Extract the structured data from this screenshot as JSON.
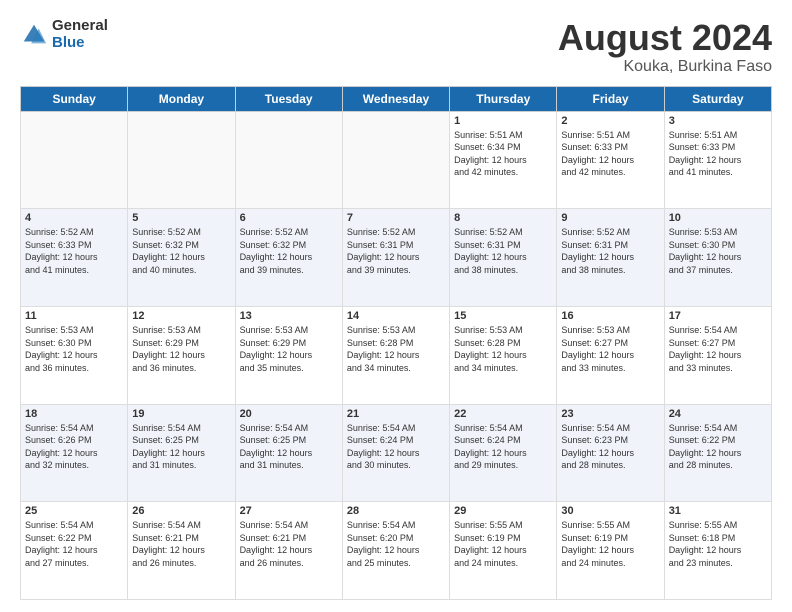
{
  "logo": {
    "general": "General",
    "blue": "Blue"
  },
  "title": {
    "month_year": "August 2024",
    "location": "Kouka, Burkina Faso"
  },
  "days_of_week": [
    "Sunday",
    "Monday",
    "Tuesday",
    "Wednesday",
    "Thursday",
    "Friday",
    "Saturday"
  ],
  "weeks": [
    [
      {
        "day": "",
        "info": ""
      },
      {
        "day": "",
        "info": ""
      },
      {
        "day": "",
        "info": ""
      },
      {
        "day": "",
        "info": ""
      },
      {
        "day": "1",
        "info": "Sunrise: 5:51 AM\nSunset: 6:34 PM\nDaylight: 12 hours\nand 42 minutes."
      },
      {
        "day": "2",
        "info": "Sunrise: 5:51 AM\nSunset: 6:33 PM\nDaylight: 12 hours\nand 42 minutes."
      },
      {
        "day": "3",
        "info": "Sunrise: 5:51 AM\nSunset: 6:33 PM\nDaylight: 12 hours\nand 41 minutes."
      }
    ],
    [
      {
        "day": "4",
        "info": "Sunrise: 5:52 AM\nSunset: 6:33 PM\nDaylight: 12 hours\nand 41 minutes."
      },
      {
        "day": "5",
        "info": "Sunrise: 5:52 AM\nSunset: 6:32 PM\nDaylight: 12 hours\nand 40 minutes."
      },
      {
        "day": "6",
        "info": "Sunrise: 5:52 AM\nSunset: 6:32 PM\nDaylight: 12 hours\nand 39 minutes."
      },
      {
        "day": "7",
        "info": "Sunrise: 5:52 AM\nSunset: 6:31 PM\nDaylight: 12 hours\nand 39 minutes."
      },
      {
        "day": "8",
        "info": "Sunrise: 5:52 AM\nSunset: 6:31 PM\nDaylight: 12 hours\nand 38 minutes."
      },
      {
        "day": "9",
        "info": "Sunrise: 5:52 AM\nSunset: 6:31 PM\nDaylight: 12 hours\nand 38 minutes."
      },
      {
        "day": "10",
        "info": "Sunrise: 5:53 AM\nSunset: 6:30 PM\nDaylight: 12 hours\nand 37 minutes."
      }
    ],
    [
      {
        "day": "11",
        "info": "Sunrise: 5:53 AM\nSunset: 6:30 PM\nDaylight: 12 hours\nand 36 minutes."
      },
      {
        "day": "12",
        "info": "Sunrise: 5:53 AM\nSunset: 6:29 PM\nDaylight: 12 hours\nand 36 minutes."
      },
      {
        "day": "13",
        "info": "Sunrise: 5:53 AM\nSunset: 6:29 PM\nDaylight: 12 hours\nand 35 minutes."
      },
      {
        "day": "14",
        "info": "Sunrise: 5:53 AM\nSunset: 6:28 PM\nDaylight: 12 hours\nand 34 minutes."
      },
      {
        "day": "15",
        "info": "Sunrise: 5:53 AM\nSunset: 6:28 PM\nDaylight: 12 hours\nand 34 minutes."
      },
      {
        "day": "16",
        "info": "Sunrise: 5:53 AM\nSunset: 6:27 PM\nDaylight: 12 hours\nand 33 minutes."
      },
      {
        "day": "17",
        "info": "Sunrise: 5:54 AM\nSunset: 6:27 PM\nDaylight: 12 hours\nand 33 minutes."
      }
    ],
    [
      {
        "day": "18",
        "info": "Sunrise: 5:54 AM\nSunset: 6:26 PM\nDaylight: 12 hours\nand 32 minutes."
      },
      {
        "day": "19",
        "info": "Sunrise: 5:54 AM\nSunset: 6:25 PM\nDaylight: 12 hours\nand 31 minutes."
      },
      {
        "day": "20",
        "info": "Sunrise: 5:54 AM\nSunset: 6:25 PM\nDaylight: 12 hours\nand 31 minutes."
      },
      {
        "day": "21",
        "info": "Sunrise: 5:54 AM\nSunset: 6:24 PM\nDaylight: 12 hours\nand 30 minutes."
      },
      {
        "day": "22",
        "info": "Sunrise: 5:54 AM\nSunset: 6:24 PM\nDaylight: 12 hours\nand 29 minutes."
      },
      {
        "day": "23",
        "info": "Sunrise: 5:54 AM\nSunset: 6:23 PM\nDaylight: 12 hours\nand 28 minutes."
      },
      {
        "day": "24",
        "info": "Sunrise: 5:54 AM\nSunset: 6:22 PM\nDaylight: 12 hours\nand 28 minutes."
      }
    ],
    [
      {
        "day": "25",
        "info": "Sunrise: 5:54 AM\nSunset: 6:22 PM\nDaylight: 12 hours\nand 27 minutes."
      },
      {
        "day": "26",
        "info": "Sunrise: 5:54 AM\nSunset: 6:21 PM\nDaylight: 12 hours\nand 26 minutes."
      },
      {
        "day": "27",
        "info": "Sunrise: 5:54 AM\nSunset: 6:21 PM\nDaylight: 12 hours\nand 26 minutes."
      },
      {
        "day": "28",
        "info": "Sunrise: 5:54 AM\nSunset: 6:20 PM\nDaylight: 12 hours\nand 25 minutes."
      },
      {
        "day": "29",
        "info": "Sunrise: 5:55 AM\nSunset: 6:19 PM\nDaylight: 12 hours\nand 24 minutes."
      },
      {
        "day": "30",
        "info": "Sunrise: 5:55 AM\nSunset: 6:19 PM\nDaylight: 12 hours\nand 24 minutes."
      },
      {
        "day": "31",
        "info": "Sunrise: 5:55 AM\nSunset: 6:18 PM\nDaylight: 12 hours\nand 23 minutes."
      }
    ]
  ]
}
